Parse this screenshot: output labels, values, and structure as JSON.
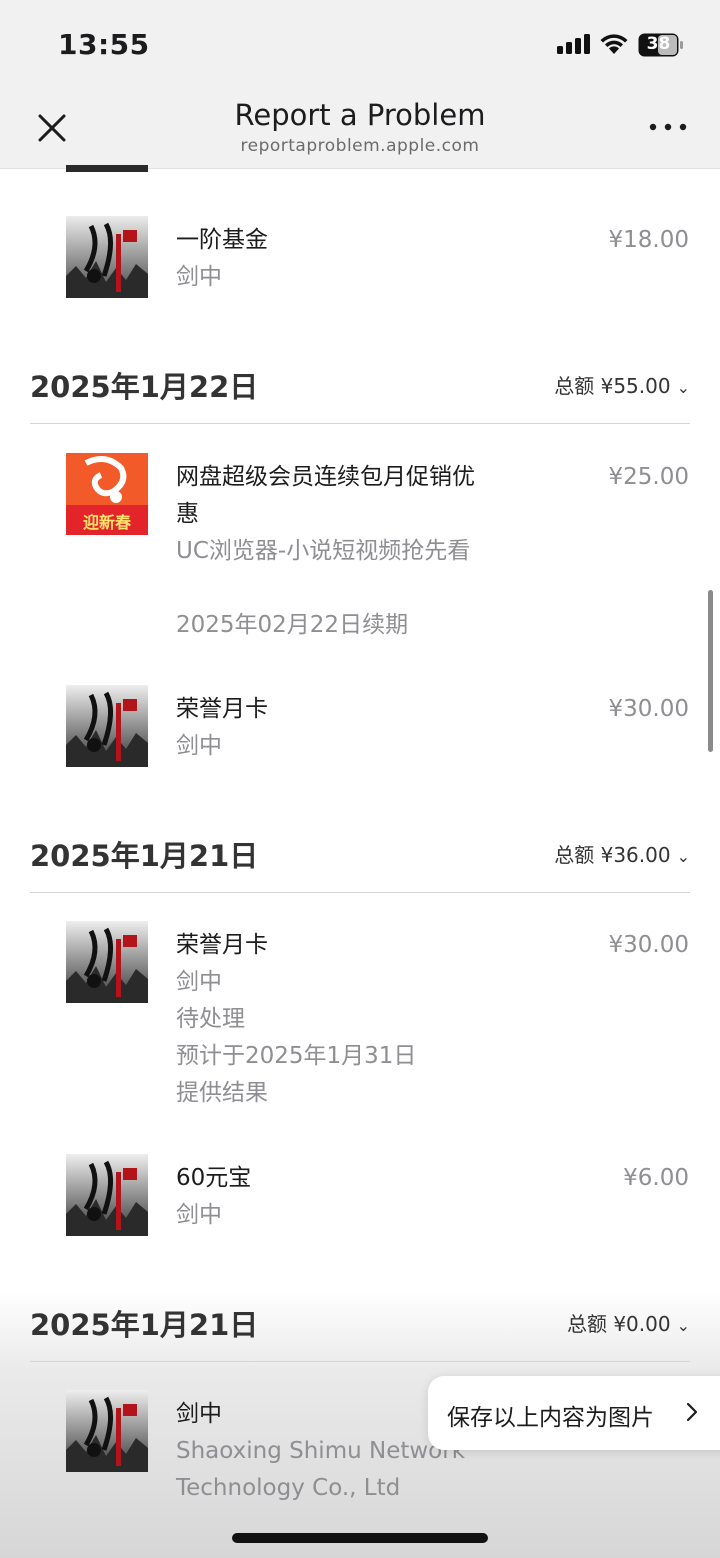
{
  "status": {
    "time": "13:55",
    "battery": "38"
  },
  "nav": {
    "title": "Report a Problem",
    "subtitle": "reportaproblem.apple.com"
  },
  "groups": [
    {
      "date": "",
      "total": "",
      "items": [
        {
          "name": "一阶基金",
          "subs": [
            "剑中"
          ],
          "price": "¥18.00",
          "icon": "jianzhong-game-icon"
        }
      ]
    },
    {
      "date": "2025年1月22日",
      "total": "总额 ¥55.00",
      "items": [
        {
          "name": "网盘超级会员连续包月促销优惠",
          "subs": [
            "UC浏览器-小说短视频抢先看",
            "2025年02月22日续期"
          ],
          "price": "¥25.00",
          "icon": "uc-browser-icon",
          "badge": "迎新春"
        },
        {
          "name": "荣誉月卡",
          "subs": [
            "剑中"
          ],
          "price": "¥30.00",
          "icon": "jianzhong-game-icon"
        }
      ]
    },
    {
      "date": "2025年1月21日",
      "total": "总额 ¥36.00",
      "items": [
        {
          "name": "荣誉月卡",
          "subs": [
            "剑中",
            "待处理",
            "预计于2025年1月31日提供结果"
          ],
          "price": "¥30.00",
          "icon": "jianzhong-game-icon"
        },
        {
          "name": "60元宝",
          "subs": [
            "剑中"
          ],
          "price": "¥6.00",
          "icon": "jianzhong-game-icon"
        }
      ]
    },
    {
      "date": "2025年1月21日",
      "total": "总额 ¥0.00",
      "items": [
        {
          "name": "剑中",
          "subs": [
            "Shaoxing Shimu Network Technology Co., Ltd"
          ],
          "price": "",
          "icon": "jianzhong-game-icon"
        }
      ]
    }
  ],
  "save_button": {
    "label": "保存以上内容为图片"
  },
  "colors": {
    "secondary_text": "#8e8e93",
    "header_bg": "#f1f1f1",
    "uc_orange": "#f26b2b",
    "uc_red": "#e3242b"
  }
}
